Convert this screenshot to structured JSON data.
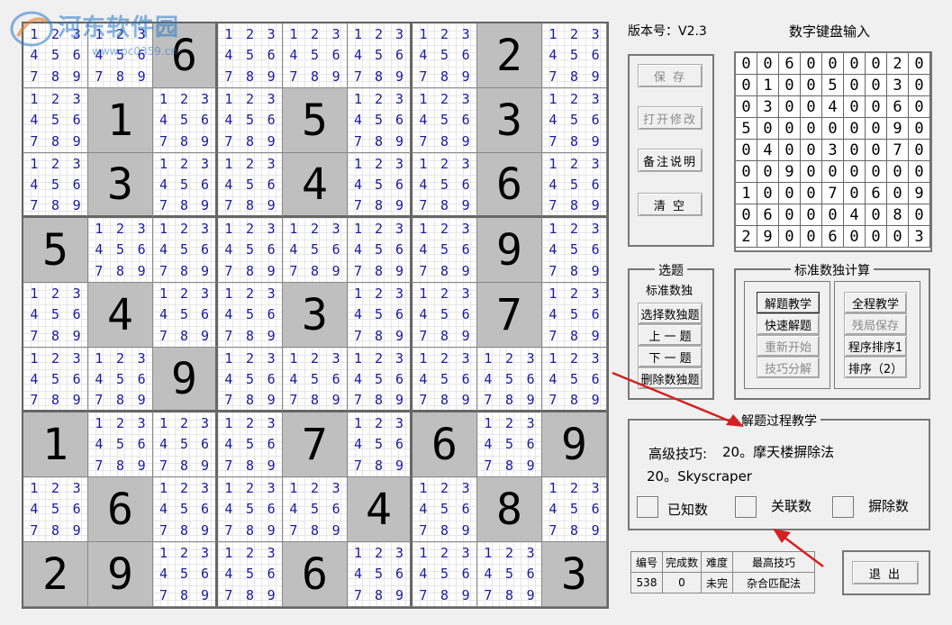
{
  "watermark": {
    "text": "河东软件园",
    "url": "www.pc0359.cn"
  },
  "version_label": "版本号：V2.3",
  "keypad_title": "数字键盘输入",
  "file_buttons": {
    "save": "保 存",
    "open_edit": "打开修改",
    "notes": "备注说明",
    "clear": "清 空"
  },
  "select_panel": {
    "title": "选题",
    "type": "标准数独",
    "buttons": [
      "选择数独题",
      "上 一 题",
      "下 一 题",
      "删除数独题"
    ]
  },
  "calc_panel": {
    "title": "标准数独计算",
    "left_buttons": [
      "解题教学",
      "快速解题",
      "重新开始",
      "技巧分解"
    ],
    "right_buttons": [
      "全程教学",
      "残局保存",
      "程序排序1",
      "排序（2）"
    ]
  },
  "teach_panel": {
    "title": "解题过程教学",
    "skill_label": "高级技巧:",
    "skill_value": "20。摩天楼摒除法",
    "skill_english": "20。Skyscraper",
    "legend": [
      "已知数",
      "关联数",
      "摒除数"
    ]
  },
  "info_table": {
    "headers": [
      "编号",
      "完成数",
      "难度",
      "最高技巧"
    ],
    "values": [
      "538",
      "0",
      "未完",
      "杂合匹配法"
    ]
  },
  "exit_button": "退 出",
  "keypad_values": [
    [
      0,
      0,
      6,
      0,
      0,
      0,
      0,
      2,
      0
    ],
    [
      0,
      1,
      0,
      0,
      5,
      0,
      0,
      3,
      0
    ],
    [
      0,
      3,
      0,
      0,
      4,
      0,
      0,
      6,
      0
    ],
    [
      5,
      0,
      0,
      0,
      0,
      0,
      0,
      9,
      0
    ],
    [
      0,
      4,
      0,
      0,
      3,
      0,
      0,
      7,
      0
    ],
    [
      0,
      0,
      9,
      0,
      0,
      0,
      0,
      0,
      0
    ],
    [
      1,
      0,
      0,
      0,
      7,
      0,
      6,
      0,
      9
    ],
    [
      0,
      6,
      0,
      0,
      0,
      4,
      0,
      8,
      0
    ],
    [
      2,
      9,
      0,
      0,
      6,
      0,
      0,
      0,
      3
    ]
  ],
  "board": {
    "candidates": [
      "1",
      "2",
      "3",
      "4",
      "5",
      "6",
      "7",
      "8",
      "9"
    ],
    "givens": [
      [
        0,
        0,
        6,
        0,
        0,
        0,
        0,
        2,
        0
      ],
      [
        0,
        1,
        0,
        0,
        5,
        0,
        0,
        3,
        0
      ],
      [
        0,
        3,
        0,
        0,
        4,
        0,
        0,
        6,
        0
      ],
      [
        5,
        0,
        0,
        0,
        0,
        0,
        0,
        9,
        0
      ],
      [
        0,
        4,
        0,
        0,
        3,
        0,
        0,
        7,
        0
      ],
      [
        0,
        0,
        9,
        0,
        0,
        0,
        0,
        0,
        0
      ],
      [
        1,
        0,
        0,
        0,
        7,
        0,
        6,
        0,
        9
      ],
      [
        0,
        6,
        0,
        0,
        0,
        4,
        0,
        8,
        0
      ],
      [
        2,
        9,
        0,
        0,
        6,
        0,
        0,
        0,
        3
      ]
    ]
  }
}
